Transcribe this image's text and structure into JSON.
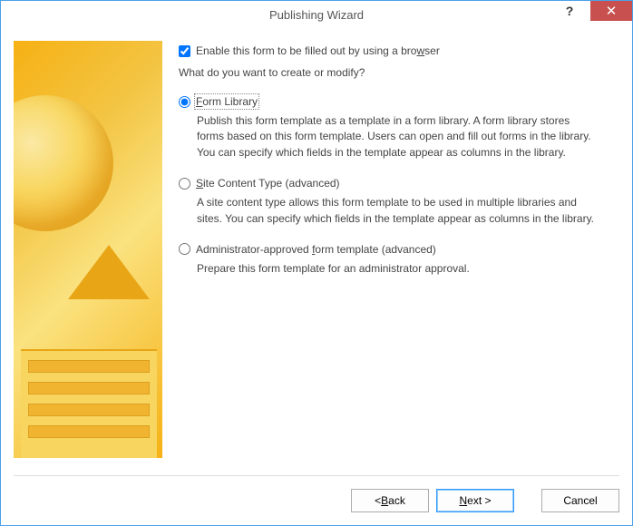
{
  "titlebar": {
    "title": "Publishing Wizard"
  },
  "checkbox": {
    "label_pre": "Enable this form to be filled out by using a bro",
    "label_ul": "w",
    "label_post": "ser",
    "checked": true
  },
  "question": "What do you want to create or modify?",
  "options": {
    "form_library": {
      "label_ul": "F",
      "label_post": "orm Library",
      "desc": "Publish this form template as a template in a form library. A form library stores forms based on this form template. Users can open and fill out forms in the library. You can specify which fields in the template appear as columns in the library."
    },
    "site_content": {
      "label_ul": "S",
      "label_post": "ite Content Type (advanced)",
      "desc": "A site content type allows this form template to be used in multiple libraries and sites. You can specify which fields in the template appear as columns in the library."
    },
    "admin_approved": {
      "label_pre": "Administrator-approved ",
      "label_ul": "f",
      "label_post": "orm template (advanced)",
      "desc": "Prepare this form template for an administrator approval."
    }
  },
  "buttons": {
    "back_pre": "< ",
    "back_ul": "B",
    "back_post": "ack",
    "next_ul": "N",
    "next_post": "ext >",
    "cancel": "Cancel"
  }
}
